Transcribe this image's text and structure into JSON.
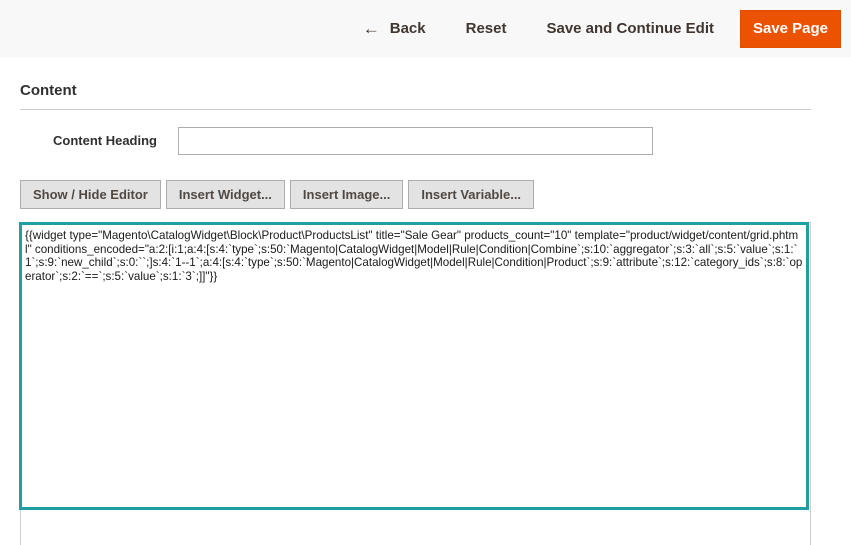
{
  "header": {
    "back_label": "Back",
    "back_icon": "arrow-left-icon",
    "back_glyph": "←",
    "reset_label": "Reset",
    "save_continue_label": "Save and Continue Edit",
    "save_page_label": "Save Page",
    "accent_color": "#eb5202"
  },
  "content": {
    "section_title": "Content",
    "heading_label": "Content Heading",
    "heading_value": ""
  },
  "editor_toolbar": {
    "show_hide": "Show / Hide Editor",
    "insert_widget": "Insert Widget...",
    "insert_image": "Insert Image...",
    "insert_variable": "Insert Variable..."
  },
  "editor": {
    "text": "{{widget type=\"Magento\\CatalogWidget\\Block\\Product\\ProductsList\" title=\"Sale Gear\" products_count=\"10\" template=\"product/widget/content/grid.phtml\" conditions_encoded=\"a:2:[i:1;a:4:[s:4:`type`;s:50:`Magento|CatalogWidget|Model|Rule|Condition|Combine`;s:10:`aggregator`;s:3:`all`;s:5:`value`;s:1:`1`;s:9:`new_child`;s:0:``;]s:4:`1--1`;a:4:[s:4:`type`;s:50:`Magento|CatalogWidget|Model|Rule|Condition|Product`;s:9:`attribute`;s:12:`category_ids`;s:8:`operator`;s:2:`==`;s:5:`value`;s:1:`3`;]]\"}}",
    "focus_color": "#1e9fa3"
  }
}
